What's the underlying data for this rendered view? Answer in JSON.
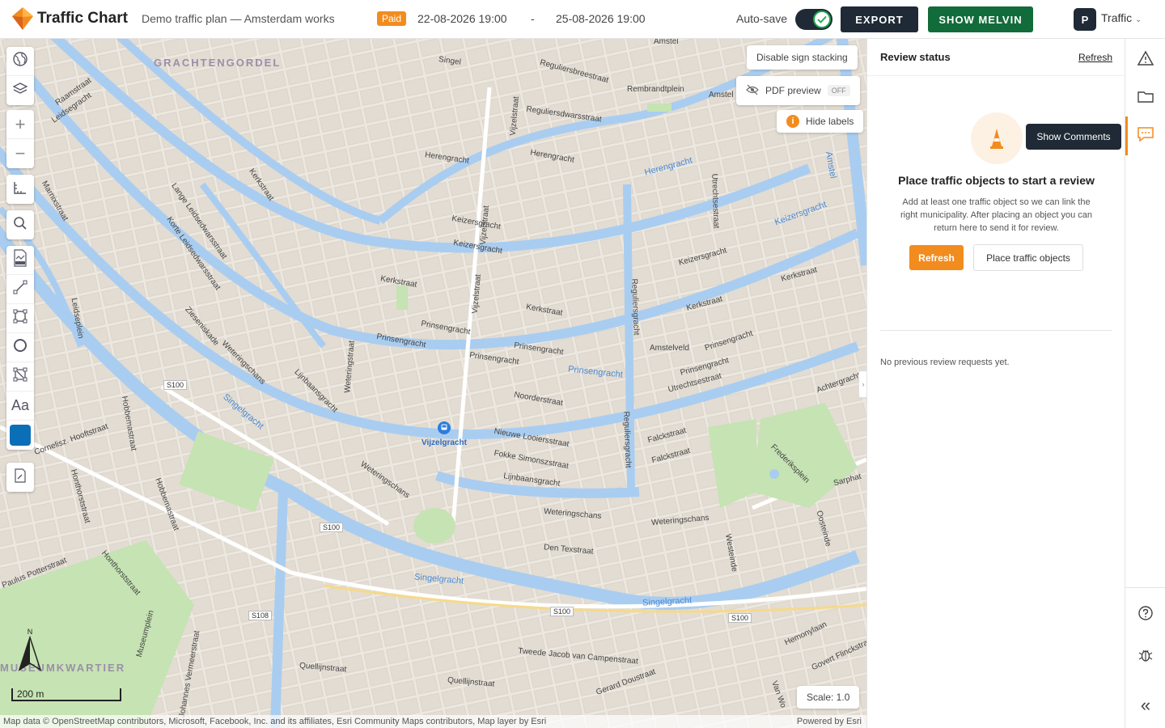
{
  "header": {
    "brand": "Traffic Chart",
    "plan_title": "Demo traffic plan — Amsterdam works",
    "paid_badge": "Paid",
    "start_date": "22-08-2026 19:00",
    "separator": "-",
    "end_date": "25-08-2026 19:00",
    "autosave_label": "Auto-save",
    "autosave_on": true,
    "export_label": "EXPORT",
    "melvin_label": "SHOW MELVIN",
    "user_initial": "P",
    "user_menu_label": "Traffic"
  },
  "map": {
    "controls": {
      "sign_stacking": "Disable sign stacking",
      "pdf_preview": "PDF preview",
      "pdf_preview_state": "OFF",
      "hide_labels": "Hide labels",
      "info_glyph": "i",
      "scale": "Scale: 1.0"
    },
    "scalebar": "200 m",
    "north": "N",
    "attribution": "Map data © OpenStreetMap contributors, Microsoft, Facebook, Inc. and its affiliates, Esri Community Maps contributors, Map layer by Esri",
    "powered_by": "Powered by Esri",
    "station": "Vijzelgracht",
    "labels": {
      "gracht": "GRACHTENGORDEL",
      "museum": "MUSEUMKWARTIER",
      "herengracht": "Herengracht",
      "keizersgracht": "Keizersgracht",
      "prinsengracht": "Prinsengracht",
      "singelgracht": "Singelgracht",
      "vijzelstraat": "Vijzelstraat",
      "kerkstraat": "Kerkstraat",
      "weteringschans": "Weteringschans",
      "singel": "Singel",
      "amstel": "Amstel",
      "regulier": "Reguliersgracht",
      "utrecht": "Utrechtsestraat",
      "noorder": "Noorderstraat",
      "looiers": "Nieuwe Looiersstraat",
      "fokke": "Fokke Simonszstraat",
      "lijnbaans": "Lijnbaansgracht",
      "falck": "Falckstraat",
      "texstraat": "Den Texstraat",
      "campen": "Tweede Jacob van Campenstraat",
      "quellijn": "Quellijnstraat",
      "dou": "Gerard Doustraat",
      "hemony": "Hemonylaan",
      "sarphati": "Sarphat",
      "frederik": "Frederiksplein",
      "oosteinde": "Oosteinde",
      "westeinde": "Westeinde",
      "hobbema": "Hobbemastraat",
      "honthorst": "Honthorststraat",
      "potter": "Paulus Potterstraat",
      "leidse": "Leidsegracht",
      "marnix": "Marnixstraat",
      "rembrandt": "Rembrandtplein",
      "amstelveld": "Amstelveld",
      "weteringstraat": "Weteringstraat",
      "lange": "Lange Leidsedwarsstraat",
      "korte": "Korte Leidsedwarsstraat",
      "zieseniskade": "Zieseniskade",
      "reguliersdwars": "Reguliersdwarsstraat",
      "reguliersbree": "Reguliersbreestraat",
      "raamstraat": "Raamstraat",
      "museumplein": "Museumplein",
      "vermeer": "Johannes Vermeerstraat",
      "cornelisz": "Cornelisz. Hooftstraat",
      "achtergracht": "Achtergracht",
      "govert": "Govert Flinckstraat",
      "vanwoustraat": "Van Wo",
      "leidseplein": "Leidseplein"
    },
    "roads": [
      "S100",
      "S100",
      "S100",
      "S100",
      "S108"
    ]
  },
  "panel": {
    "title": "Review status",
    "refresh_link": "Refresh",
    "tooltip": "Show Comments",
    "empty_title": "Place traffic objects to start a review",
    "empty_desc": "Add at least one traffic object so we can link the right municipality. After placing an object you can return here to send it for review.",
    "refresh_button": "Refresh",
    "place_button": "Place traffic objects",
    "no_reviews": "No previous review requests yet."
  },
  "colors": {
    "accent": "#f28c1e",
    "dark": "#1f2a36",
    "green": "#126b3a",
    "water": "#a9cdf0",
    "park": "#c6e3b3",
    "tool_color": "#0b6fb8"
  }
}
